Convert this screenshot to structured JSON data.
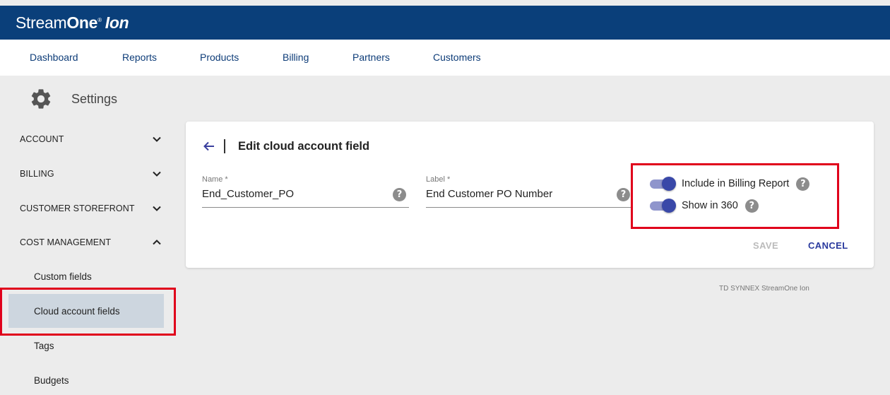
{
  "header": {
    "brand_part1": "Stream",
    "brand_part2": "One",
    "brand_reg": "®",
    "brand_part3": "Ion"
  },
  "nav": {
    "items": [
      "Dashboard",
      "Reports",
      "Products",
      "Billing",
      "Partners",
      "Customers"
    ]
  },
  "page": {
    "title": "Settings",
    "icon": "gear-icon"
  },
  "sidebar": {
    "sections": [
      {
        "label": "ACCOUNT",
        "state": "collapsed"
      },
      {
        "label": "BILLING",
        "state": "collapsed"
      },
      {
        "label": "CUSTOMER STOREFRONT",
        "state": "collapsed"
      },
      {
        "label": "COST MANAGEMENT",
        "state": "expanded"
      }
    ],
    "items": [
      "Custom fields",
      "Cloud account fields",
      "Tags",
      "Budgets"
    ],
    "selected": "Cloud account fields"
  },
  "form": {
    "title": "Edit cloud account field",
    "name_label": "Name *",
    "name_value": "End_Customer_PO",
    "label_label": "Label *",
    "label_value": "End Customer PO Number",
    "help_glyph": "?",
    "toggle_billing_label": "Include in Billing Report",
    "toggle_billing_on": true,
    "toggle_360_label": "Show in 360",
    "toggle_360_on": true,
    "save_label": "SAVE",
    "cancel_label": "CANCEL"
  },
  "footer": {
    "text": "TD SYNNEX StreamOne Ion"
  },
  "colors": {
    "header_bg": "#0a3f7a",
    "nav_text": "#0d3c78",
    "accent": "#3948a8",
    "highlight_box": "#e0001b",
    "selected_bg": "#cdd6df"
  }
}
